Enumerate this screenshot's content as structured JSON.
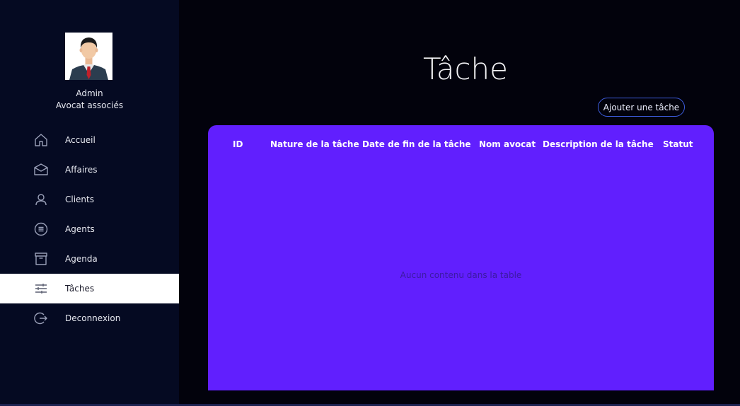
{
  "user": {
    "name": "Admin",
    "role": "Avocat associés"
  },
  "sidebar": {
    "items": [
      {
        "label": "Accueil",
        "icon": "home-icon"
      },
      {
        "label": "Affaires",
        "icon": "envelope-icon"
      },
      {
        "label": "Clients",
        "icon": "user-icon"
      },
      {
        "label": "Agents",
        "icon": "list-circle-icon"
      },
      {
        "label": "Agenda",
        "icon": "archive-icon"
      },
      {
        "label": "Tâches",
        "icon": "sliders-icon",
        "active": true
      },
      {
        "label": "Deconnexion",
        "icon": "logout-icon"
      }
    ]
  },
  "main": {
    "title": "Tâche",
    "add_button": "Ajouter une tâche",
    "table": {
      "columns": [
        "ID",
        "Nature de la tâche",
        "Date de fin de la tâche",
        "Nom avocat",
        "Description de la tâche",
        "Statut"
      ],
      "empty_message": "Aucun contenu dans la table"
    }
  },
  "colors": {
    "sidebar_bg": "#050a22",
    "page_bg": "#02020c",
    "table_bg": "#611ffe",
    "button_border": "#3e5de0",
    "active_item_bg": "#ffffff"
  }
}
